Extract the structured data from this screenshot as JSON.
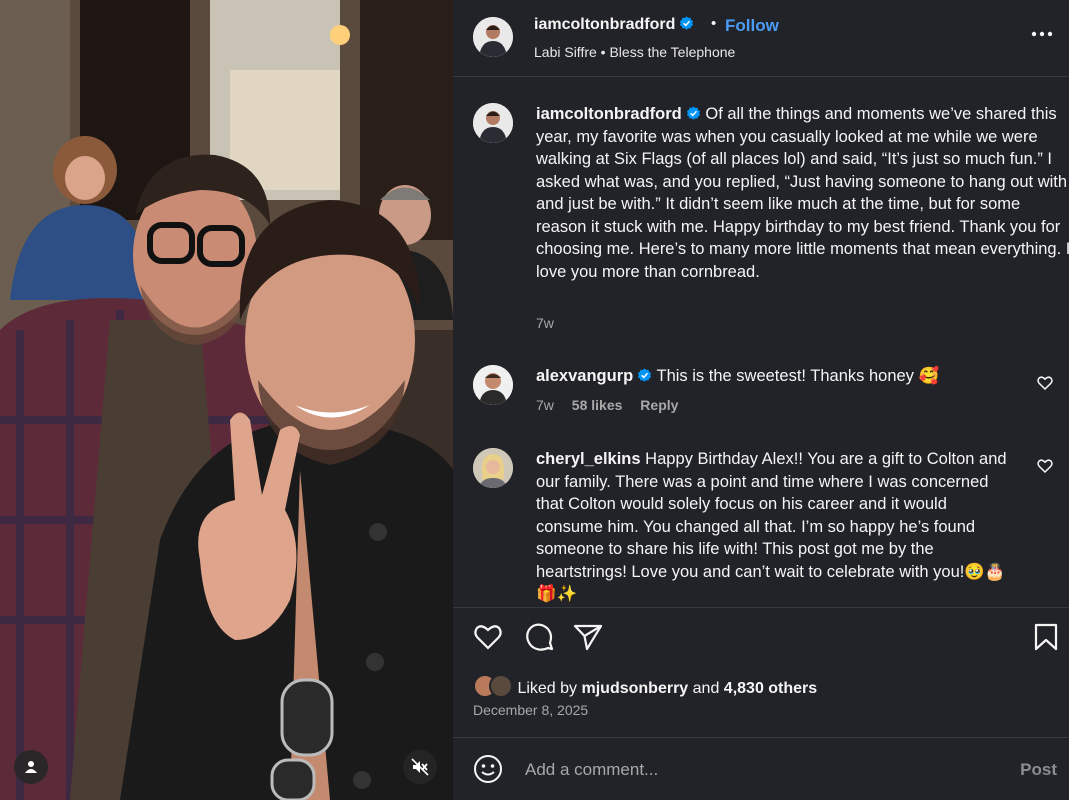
{
  "post": {
    "author": "iamcoltonbradford",
    "follow_label": "Follow",
    "dot": "•",
    "audio": "Labi Siffre • Bless the Telephone",
    "caption": "Of all the things and moments we’ve shared this year, my favorite was when you casually looked at me while we were walking at Six Flags (of all places lol) and said, “It’s just so much fun.” I asked what was, and you replied, “Just having someone to hang out with and just be with.” It didn’t seem like much at the time, but for some reason it stuck with me. Happy birthday to my best friend. Thank you for choosing me. Here’s to many more little moments that mean everything. I love you more than cornbread.",
    "time": "7w"
  },
  "comments": [
    {
      "user": "alexvangurp",
      "text": "This is the sweetest! Thanks honey 🥰",
      "time": "7w",
      "likes": "58 likes",
      "reply_label": "Reply"
    },
    {
      "user": "cheryl_elkins",
      "text": "Happy Birthday Alex!! You are a gift to Colton and our family. There was a point and time where I was concerned that Colton would solely focus on his career and it would consume him. You changed all that. I’m so happy he’s found someone to share his life with! This post got me by the heartstrings! Love you and can’t wait to celebrate with you!🥹🎂🎁✨"
    }
  ],
  "likes": {
    "prefix": "Liked by",
    "user": "mjudsonberry",
    "and": "and",
    "count": "4,830 others"
  },
  "date": "December 8, 2025",
  "composer": {
    "placeholder": "Add a comment...",
    "post_label": "Post"
  },
  "icons": {
    "verified": "verified-badge-icon",
    "more": "more-options-icon",
    "like": "heart-icon",
    "comment": "comment-icon",
    "share": "share-icon",
    "save": "bookmark-icon",
    "emoji": "emoji-icon",
    "user": "user-icon",
    "mute": "mute-icon"
  },
  "colors": {
    "panel_bg": "#212328",
    "link_blue": "#4a9cf5",
    "verified_blue": "#0095f6",
    "muted_text": "#a8a8a8"
  }
}
